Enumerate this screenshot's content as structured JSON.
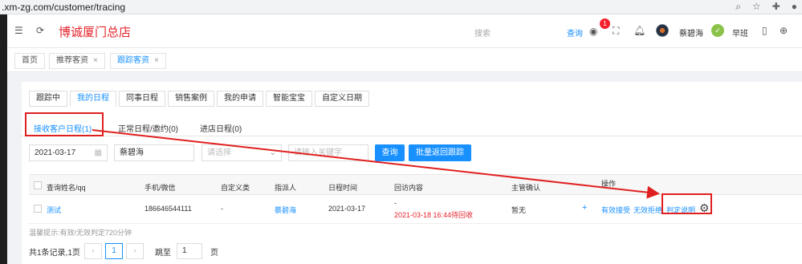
{
  "browser": {
    "url": ".xm-zg.com/customer/tracing"
  },
  "header": {
    "brand": "博诚厦门总店",
    "search_placeholder": "搜索",
    "search_link": "查询",
    "notification_count": "1",
    "user_name": "蔡碧海",
    "shift_label": "早班"
  },
  "page_tabs": [
    {
      "label": "首页"
    },
    {
      "label": "推荐客资",
      "close": "×"
    },
    {
      "label": "跟踪客资",
      "close": "×"
    }
  ],
  "tabs": [
    "跟踪中",
    "我的日程",
    "同事日程",
    "销售案例",
    "我的申请",
    "智能宝宝",
    "自定义日期"
  ],
  "sub_tabs": [
    "接收客户日程(1)",
    "正常日程/邀约(0)",
    "进店日程(0)"
  ],
  "filters": {
    "date": "2021-03-17",
    "person": "蔡碧海",
    "select_placeholder": "请选择",
    "keyword_placeholder": "请输入关键字",
    "query_button": "查询",
    "batch_button": "批量返回跟踪"
  },
  "table": {
    "headers": [
      "查询姓名/qq",
      "手机/微信",
      "自定义类",
      "指派人",
      "日程时间",
      "回访内容",
      "主管确认",
      "操作"
    ],
    "rows": [
      {
        "name": "测试",
        "phone": "186646544111",
        "custom": "-",
        "assignee": "蔡碧海",
        "date": "2021-03-17",
        "visit_line1": "-",
        "visit_line2": "2021-03-18 16:44待回收",
        "supervisor": "暂无",
        "plus": "+",
        "actions": [
          "有效接受",
          "无效拒绝",
          "判定说明"
        ]
      }
    ]
  },
  "tip": "温馨提示:有效/无效判定720分钟",
  "pagination": {
    "summary": "共1条记录,1页",
    "prev": "‹",
    "current": "1",
    "next": "›",
    "jump_label": "跳至",
    "jump_value": "1",
    "page_unit": "页"
  },
  "colors": {
    "brand": "#e4252c",
    "accent": "#1890ff",
    "annotation": "#e02020"
  }
}
